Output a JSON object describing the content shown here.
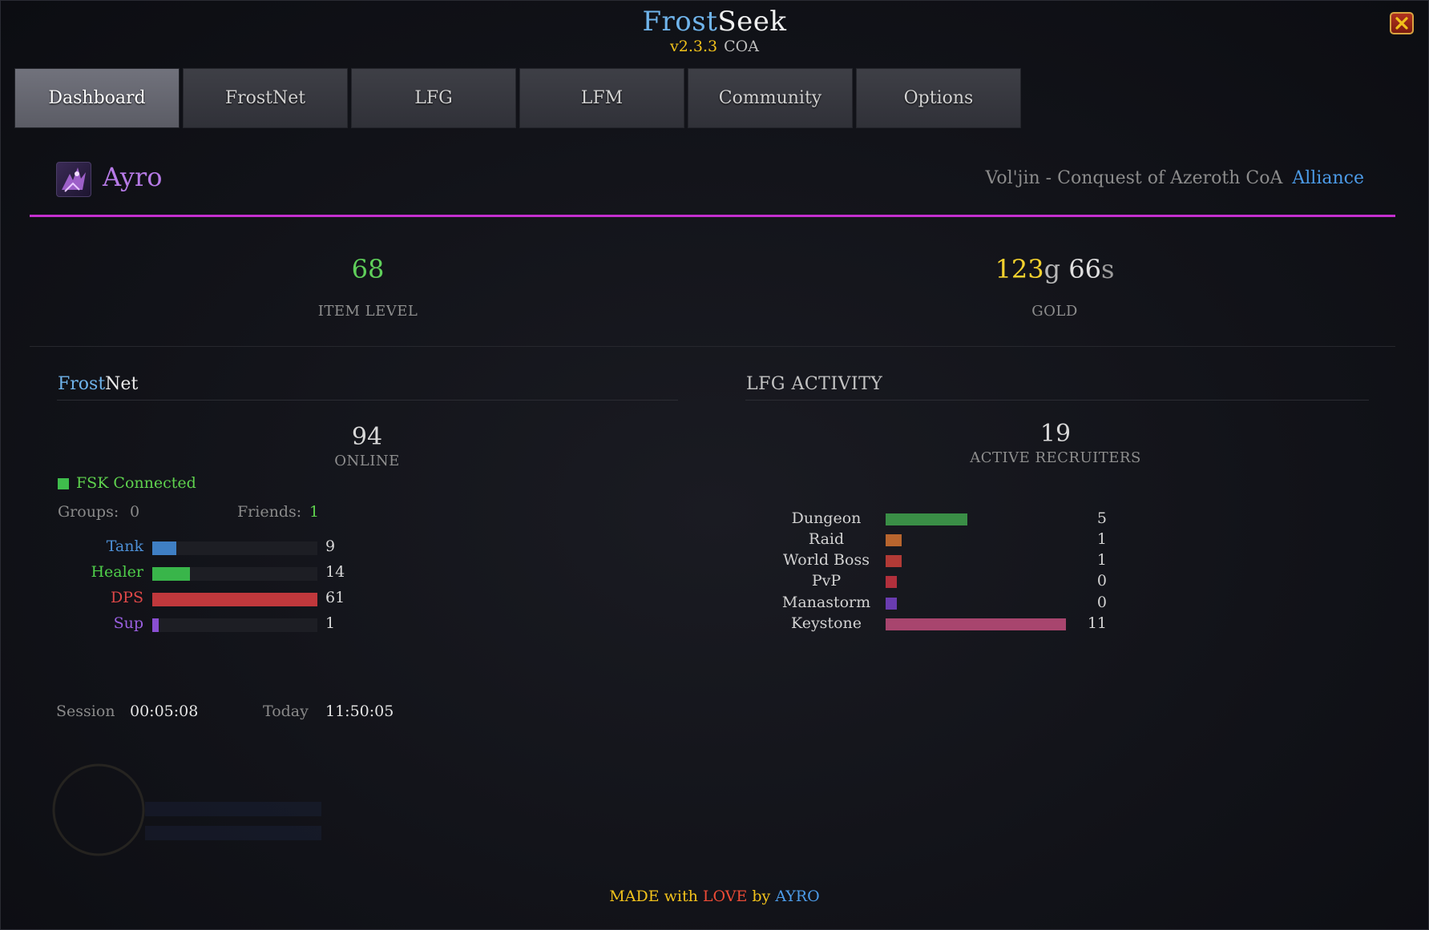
{
  "window": {
    "title_part1": "Frost",
    "title_part2": "Seek",
    "version": "v2.3.3",
    "realm_tag": "COA"
  },
  "tabs": [
    {
      "label": "Dashboard",
      "active": true
    },
    {
      "label": "FrostNet",
      "active": false
    },
    {
      "label": "LFG",
      "active": false
    },
    {
      "label": "LFM",
      "active": false
    },
    {
      "label": "Community",
      "active": false
    },
    {
      "label": "Options",
      "active": false
    }
  ],
  "character": {
    "name": "Ayro",
    "realm": "Vol'jin - Conquest of Azeroth CoA",
    "faction": "Alliance",
    "class_color": "#b67ae6"
  },
  "stats": {
    "item_level": "68",
    "item_level_label": "ITEM LEVEL",
    "gold": "123",
    "gold_unit": "g",
    "silver": "66",
    "silver_unit": "s",
    "gold_label": "GOLD"
  },
  "frostnet": {
    "title_part1": "Frost",
    "title_part2": "Net",
    "online": "94",
    "online_label": "ONLINE",
    "status": "FSK Connected",
    "groups_label": "Groups:",
    "groups": "0",
    "friends_label": "Friends:",
    "friends": "1",
    "roles": [
      {
        "name": "Tank",
        "value": 9,
        "color": "#3f7fc4",
        "text_color": "#4d8fd6"
      },
      {
        "name": "Healer",
        "value": 14,
        "color": "#39b54a",
        "text_color": "#4fcf4a"
      },
      {
        "name": "DPS",
        "value": 61,
        "color": "#c0383c",
        "text_color": "#e04848"
      },
      {
        "name": "Sup",
        "value": 1,
        "color": "#8a4fd2",
        "text_color": "#9a5fe0"
      }
    ],
    "role_max": 61
  },
  "lfg_activity": {
    "title": "LFG ACTIVITY",
    "recruiters": "19",
    "recruiters_label": "ACTIVE RECRUITERS",
    "items": [
      {
        "name": "Dungeon",
        "value": 5,
        "color": "#3a8e46"
      },
      {
        "name": "Raid",
        "value": 1,
        "color": "#b8652e"
      },
      {
        "name": "World Boss",
        "value": 1,
        "color": "#b23a36"
      },
      {
        "name": "PvP",
        "value": 0,
        "color": "#b2303c"
      },
      {
        "name": "Manastorm",
        "value": 0,
        "color": "#6a3cb0"
      },
      {
        "name": "Keystone",
        "value": 11,
        "color": "#a8456e"
      }
    ],
    "max": 11
  },
  "session": {
    "session_label": "Session",
    "session_time": "00:05:08",
    "today_label": "Today",
    "today_time": "11:50:05"
  },
  "footer": {
    "made": "MADE with",
    "love": "LOVE",
    "by": "by",
    "author": "AYRO"
  }
}
